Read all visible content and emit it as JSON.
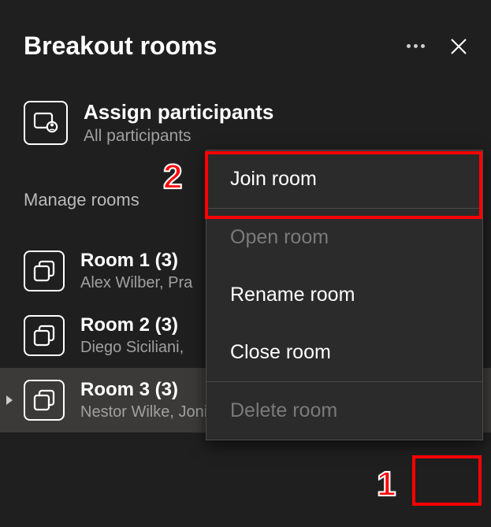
{
  "header": {
    "title": "Breakout rooms"
  },
  "assign": {
    "title": "Assign participants",
    "subtitle": "All participants"
  },
  "manage": {
    "label": "Manage rooms"
  },
  "rooms": [
    {
      "title": "Room 1 (3)",
      "members": "Alex Wilber, Pra"
    },
    {
      "title": "Room 2 (3)",
      "members": "Diego Siciliani,"
    },
    {
      "title": "Room 3 (3)",
      "members": "Nestor Wilke, Joni Sherman, Isaiah L..."
    }
  ],
  "menu": {
    "join": "Join room",
    "open": "Open room",
    "rename": "Rename room",
    "close": "Close room",
    "delete": "Delete room"
  },
  "callouts": {
    "c1": "1",
    "c2": "2"
  }
}
